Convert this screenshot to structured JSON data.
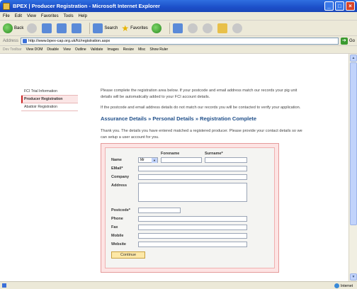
{
  "window": {
    "title": "BPEX | Producer Registration - Microsoft Internet Explorer"
  },
  "menu": [
    "File",
    "Edit",
    "View",
    "Favorites",
    "Tools",
    "Help"
  ],
  "toolbar": {
    "back": "Back",
    "search": "Search",
    "favorites": "Favorites"
  },
  "address": {
    "label": "Address",
    "url": "http://www.bpex-cap.org.uk/fci/registration.aspx",
    "go": "Go"
  },
  "devbar": {
    "items": [
      "Dev Toolbar",
      "View DOM",
      "Disable",
      "View",
      "Outline",
      "Validate",
      "Images",
      "Resize",
      "Misc",
      "Show Ruler"
    ]
  },
  "sidebar": {
    "items": [
      {
        "label": "FCI Trial Information"
      },
      {
        "label": "Producer Registration"
      },
      {
        "label": "Abattoir Registration"
      }
    ]
  },
  "main": {
    "intro1": "Please complete the registration area below. If your postcode and email address match our records your pig unit details will be automatically added to your FCI account details.",
    "intro2": "If the postcode and email address details do not match our records you will be contacted to verify your application.",
    "steps": "Assurance Details » Personal Details » Registration Complete",
    "thanks": "Thank you. The details you have entered matched a registered producer. Please provide your contact details so we can setup a user account for you."
  },
  "form": {
    "forename_hdr": "Forename",
    "surname_hdr": "Surname*",
    "title_value": "Mr",
    "labels": {
      "name": "Name",
      "email": "EMail*",
      "company": "Company",
      "address": "Address",
      "postcode": "Postcode*",
      "phone": "Phone",
      "fax": "Fax",
      "mobile": "Mobile",
      "website": "Website"
    },
    "continue": "Continue"
  },
  "status": {
    "zone": "Internet"
  }
}
